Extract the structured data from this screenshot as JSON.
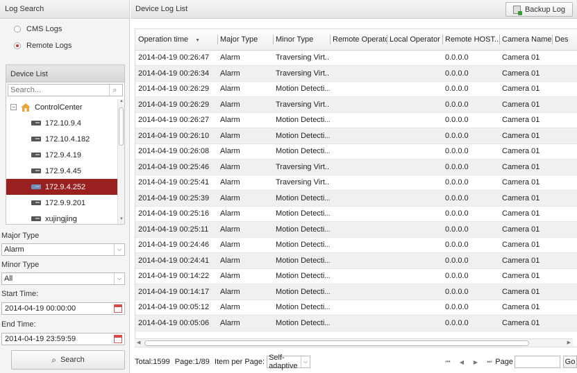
{
  "left": {
    "title": "Log Search",
    "log_modes": [
      {
        "label": "CMS Logs",
        "checked": false
      },
      {
        "label": "Remote Logs",
        "checked": true
      }
    ],
    "device_list": {
      "title": "Device List",
      "search_placeholder": "Search...",
      "root": "ControlCenter",
      "devices": [
        "172.10.9.4",
        "172.10.4.182",
        "172.9.4.19",
        "172.9.4.45",
        "172.9.4.252",
        "172.9.9.201",
        "xujingjing"
      ],
      "selected": "172.9.4.252"
    },
    "major_type": {
      "label": "Major Type",
      "value": "Alarm"
    },
    "minor_type": {
      "label": "Minor Type",
      "value": "All"
    },
    "start_time": {
      "label": "Start Time:",
      "value": "2014-04-19 00:00:00"
    },
    "end_time": {
      "label": "End Time:",
      "value": "2014-04-19 23:59:59"
    },
    "search_label": "Search"
  },
  "right": {
    "title": "Device Log List",
    "backup_label": "Backup Log",
    "columns": [
      "Operation time",
      "Major Type",
      "Minor Type",
      "Remote Operator",
      "Local Operator",
      "Remote HOST...",
      "Camera Name",
      "Des"
    ],
    "rows": [
      [
        "2014-04-19 00:26:47",
        "Alarm",
        "Traversing Virt...",
        "",
        "",
        "0.0.0.0",
        "Camera 01",
        ""
      ],
      [
        "2014-04-19 00:26:34",
        "Alarm",
        "Traversing Virt...",
        "",
        "",
        "0.0.0.0",
        "Camera 01",
        ""
      ],
      [
        "2014-04-19 00:26:29",
        "Alarm",
        "Motion Detecti...",
        "",
        "",
        "0.0.0.0",
        "Camera 01",
        ""
      ],
      [
        "2014-04-19 00:26:29",
        "Alarm",
        "Traversing Virt...",
        "",
        "",
        "0.0.0.0",
        "Camera 01",
        ""
      ],
      [
        "2014-04-19 00:26:27",
        "Alarm",
        "Motion Detecti...",
        "",
        "",
        "0.0.0.0",
        "Camera 01",
        ""
      ],
      [
        "2014-04-19 00:26:10",
        "Alarm",
        "Motion Detecti...",
        "",
        "",
        "0.0.0.0",
        "Camera 01",
        ""
      ],
      [
        "2014-04-19 00:26:08",
        "Alarm",
        "Motion Detecti...",
        "",
        "",
        "0.0.0.0",
        "Camera 01",
        ""
      ],
      [
        "2014-04-19 00:25:46",
        "Alarm",
        "Traversing Virt...",
        "",
        "",
        "0.0.0.0",
        "Camera 01",
        ""
      ],
      [
        "2014-04-19 00:25:41",
        "Alarm",
        "Traversing Virt...",
        "",
        "",
        "0.0.0.0",
        "Camera 01",
        ""
      ],
      [
        "2014-04-19 00:25:39",
        "Alarm",
        "Motion Detecti...",
        "",
        "",
        "0.0.0.0",
        "Camera 01",
        ""
      ],
      [
        "2014-04-19 00:25:16",
        "Alarm",
        "Motion Detecti...",
        "",
        "",
        "0.0.0.0",
        "Camera 01",
        ""
      ],
      [
        "2014-04-19 00:25:11",
        "Alarm",
        "Motion Detecti...",
        "",
        "",
        "0.0.0.0",
        "Camera 01",
        ""
      ],
      [
        "2014-04-19 00:24:46",
        "Alarm",
        "Motion Detecti...",
        "",
        "",
        "0.0.0.0",
        "Camera 01",
        ""
      ],
      [
        "2014-04-19 00:24:41",
        "Alarm",
        "Motion Detecti...",
        "",
        "",
        "0.0.0.0",
        "Camera 01",
        ""
      ],
      [
        "2014-04-19 00:14:22",
        "Alarm",
        "Motion Detecti...",
        "",
        "",
        "0.0.0.0",
        "Camera 01",
        ""
      ],
      [
        "2014-04-19 00:14:17",
        "Alarm",
        "Motion Detecti...",
        "",
        "",
        "0.0.0.0",
        "Camera 01",
        ""
      ],
      [
        "2014-04-19 00:05:12",
        "Alarm",
        "Motion Detecti...",
        "",
        "",
        "0.0.0.0",
        "Camera 01",
        ""
      ],
      [
        "2014-04-19 00:05:06",
        "Alarm",
        "Motion Detecti...",
        "",
        "",
        "0.0.0.0",
        "Camera 01",
        ""
      ]
    ],
    "footer": {
      "total": "Total:1599",
      "page_info": "Page:1/89",
      "per_page_label": "Item per Page:",
      "per_page_value": "Self-adaptive",
      "page_label": "Page",
      "go_label": "Go"
    }
  },
  "colors": {
    "selected_row": "#9a2020",
    "accent_radio": "#c0392b"
  }
}
